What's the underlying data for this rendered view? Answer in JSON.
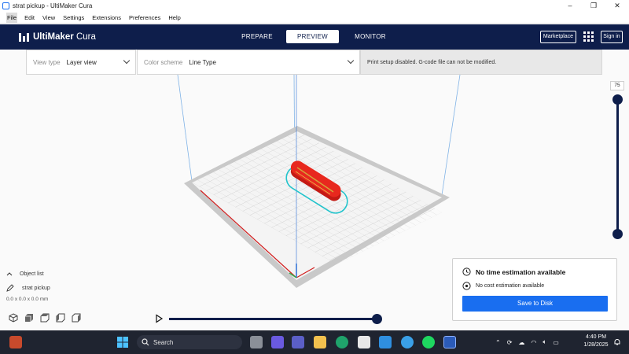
{
  "window": {
    "title": "strat pickup - UltiMaker Cura",
    "controls": [
      "–",
      "❐",
      "✕"
    ]
  },
  "menu": [
    "File",
    "Edit",
    "View",
    "Settings",
    "Extensions",
    "Preferences",
    "Help"
  ],
  "header": {
    "brand_bold": "UltiMaker",
    "brand_rest": " Cura",
    "stages": [
      "PREPARE",
      "PREVIEW",
      "MONITOR"
    ],
    "active_stage": "PREVIEW",
    "marketplace_label": "Marketplace",
    "signin_label": "Sign in"
  },
  "toolbar": {
    "view_type_label": "View type",
    "view_type_value": "Layer view",
    "color_scheme_label": "Color scheme",
    "color_scheme_value": "Line Type",
    "message": "Print setup disabled. G-code file can not be modified."
  },
  "layer_slider": {
    "current_layer": "75"
  },
  "object_list": {
    "header": "Object list",
    "item": "strat pickup",
    "dimensions": "0.0 x 0.0 x 0.0 mm"
  },
  "view_icons": [
    "3d-view-icon",
    "front-view-icon",
    "top-view-icon",
    "left-view-icon",
    "right-view-icon"
  ],
  "print_panel": {
    "time_text": "No time estimation available",
    "cost_text": "No cost estimation available",
    "save_label": "Save to Disk"
  },
  "taskbar": {
    "search_placeholder": "Search",
    "time": "4:40 PM",
    "date": "1/28/2025"
  },
  "colors": {
    "header_bg": "#0e1e4b",
    "accent_blue": "#196ef0",
    "model_red": "#e8281e",
    "skirt_cyan": "#22c4cc"
  }
}
